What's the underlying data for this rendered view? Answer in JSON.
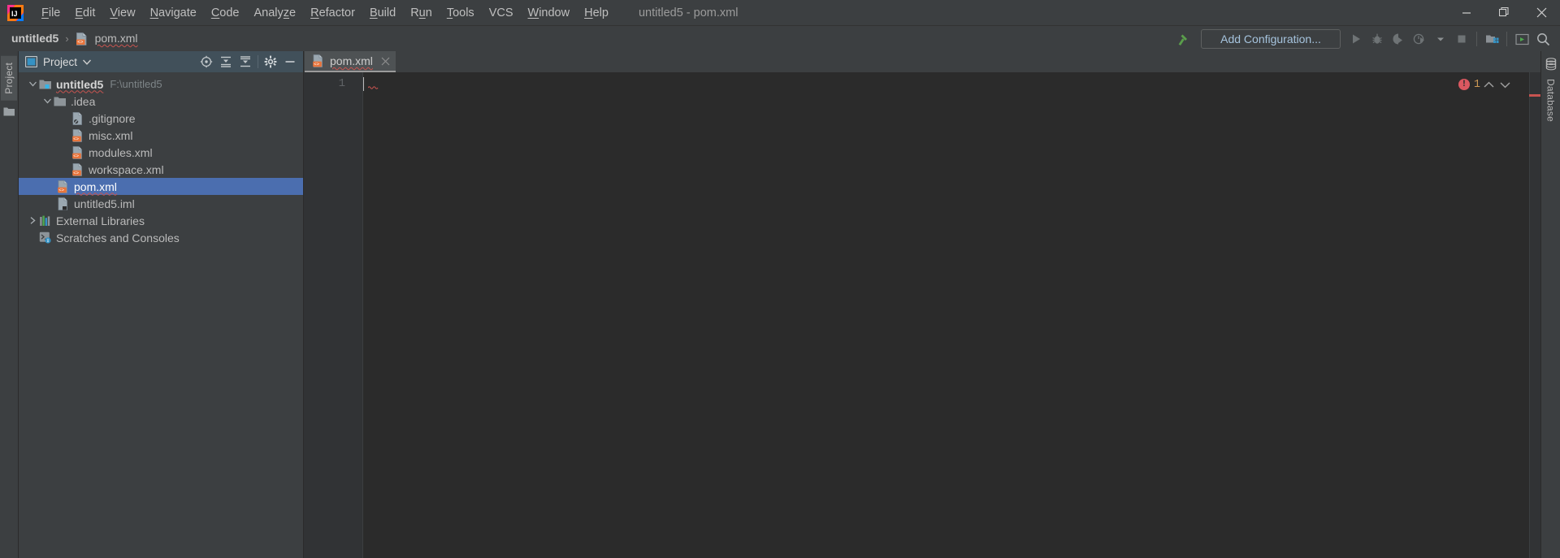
{
  "window": {
    "title": "untitled5 - pom.xml",
    "controls": {
      "minimize": "minimize-icon",
      "maximize": "maximize-icon",
      "close": "close-icon"
    }
  },
  "menubar": {
    "logo": "intellij-idea-logo",
    "items": [
      {
        "label": "File",
        "mnemonic": "F"
      },
      {
        "label": "Edit",
        "mnemonic": "E"
      },
      {
        "label": "View",
        "mnemonic": "V"
      },
      {
        "label": "Navigate",
        "mnemonic": "N"
      },
      {
        "label": "Code",
        "mnemonic": "C"
      },
      {
        "label": "Analyze",
        "mnemonic": "z"
      },
      {
        "label": "Refactor",
        "mnemonic": "R"
      },
      {
        "label": "Build",
        "mnemonic": "B"
      },
      {
        "label": "Run",
        "mnemonic": "u"
      },
      {
        "label": "Tools",
        "mnemonic": "T"
      },
      {
        "label": "VCS",
        "mnemonic": ""
      },
      {
        "label": "Window",
        "mnemonic": "W"
      },
      {
        "label": "Help",
        "mnemonic": "H"
      }
    ]
  },
  "navbar": {
    "breadcrumbs": [
      {
        "label": "untitled5",
        "icon": "",
        "bold": true
      },
      {
        "label": "pom.xml",
        "icon": "xml-file-icon",
        "bold": false
      }
    ],
    "separator": "›",
    "hammer_icon": "build-hammer-icon",
    "run_configuration": "Add Configuration...",
    "buttons": [
      {
        "name": "run-button",
        "icon": "run-play-icon"
      },
      {
        "name": "debug-button",
        "icon": "debug-bug-icon"
      },
      {
        "name": "run-coverage-button",
        "icon": "run-with-coverage-icon"
      },
      {
        "name": "profiler-button",
        "icon": "profiler-icon"
      },
      {
        "name": "profiler-dropdown",
        "icon": "chevron-down-icon"
      },
      {
        "name": "stop-button",
        "icon": "stop-square-icon"
      },
      {
        "name": "project-structure-button",
        "icon": "project-structure-icon"
      },
      {
        "name": "terminal-button",
        "icon": "terminal-icon"
      },
      {
        "name": "search-everywhere-button",
        "icon": "search-icon"
      }
    ]
  },
  "left_rail": {
    "tab_label": "Project",
    "tab_icon": "project-window-icon",
    "extra_icon": "folder-icon"
  },
  "right_rail": {
    "tab_label": "Database",
    "tab_icon": "database-icon"
  },
  "project_panel": {
    "header": {
      "view_icon": "project-view-icon",
      "title": "Project",
      "caret": "chevron-down-icon",
      "actions": [
        {
          "name": "scroll-from-source-button",
          "icon": "target-crosshair-icon"
        },
        {
          "name": "expand-all-button",
          "icon": "expand-all-icon"
        },
        {
          "name": "collapse-all-button",
          "icon": "collapse-all-icon"
        },
        {
          "name": "settings-button",
          "icon": "gear-icon"
        },
        {
          "name": "hide-button",
          "icon": "minimize-dash-icon"
        }
      ]
    },
    "tree": [
      {
        "label": "untitled5",
        "path": "F:\\untitled5",
        "icon": "module-folder-icon",
        "indent": 0,
        "arrow": "expanded",
        "bold": true,
        "selected": false,
        "squiggle": true
      },
      {
        "label": ".idea",
        "path": "",
        "icon": "folder-icon",
        "indent": 1,
        "arrow": "expanded",
        "bold": false,
        "selected": false,
        "squiggle": false
      },
      {
        "label": ".gitignore",
        "path": "",
        "icon": "gitignore-file-icon",
        "indent": 2,
        "arrow": "none",
        "bold": false,
        "selected": false,
        "squiggle": false
      },
      {
        "label": "misc.xml",
        "path": "",
        "icon": "xml-file-icon",
        "indent": 2,
        "arrow": "none",
        "bold": false,
        "selected": false,
        "squiggle": false
      },
      {
        "label": "modules.xml",
        "path": "",
        "icon": "xml-file-icon",
        "indent": 2,
        "arrow": "none",
        "bold": false,
        "selected": false,
        "squiggle": false
      },
      {
        "label": "workspace.xml",
        "path": "",
        "icon": "xml-file-icon",
        "indent": 2,
        "arrow": "none",
        "bold": false,
        "selected": false,
        "squiggle": false
      },
      {
        "label": "pom.xml",
        "path": "",
        "icon": "xml-file-icon",
        "indent": 1,
        "arrow": "none",
        "bold": false,
        "selected": true,
        "squiggle": true
      },
      {
        "label": "untitled5.iml",
        "path": "",
        "icon": "iml-file-icon",
        "indent": 1,
        "arrow": "none",
        "bold": false,
        "selected": false,
        "squiggle": false
      },
      {
        "label": "External Libraries",
        "path": "",
        "icon": "libraries-icon",
        "indent": 0,
        "arrow": "collapsed",
        "bold": false,
        "selected": false,
        "squiggle": false
      },
      {
        "label": "Scratches and Consoles",
        "path": "",
        "icon": "scratches-icon",
        "indent": 0,
        "arrow": "none",
        "bold": false,
        "selected": false,
        "squiggle": false
      }
    ]
  },
  "editor": {
    "tabs": [
      {
        "label": "pom.xml",
        "icon": "xml-file-icon",
        "active": true,
        "close_icon": "close-icon",
        "squiggle": true
      }
    ],
    "line_numbers": [
      "1"
    ],
    "content_lines": [
      ""
    ],
    "inspection": {
      "error_icon": "error-circle-icon",
      "error_count": "1",
      "prev_icon": "chevron-up-icon",
      "next_icon": "chevron-down-icon"
    }
  },
  "colors": {
    "bg_panel": "#3c3f41",
    "bg_editor": "#2b2b2b",
    "bg_gutter": "#313335",
    "selection": "#4b6eaf",
    "header_blue": "#41505a",
    "error_red": "#db5860",
    "link_blue": "#a6c4de",
    "accent_orange": "#e8743b",
    "green": "#5a9e4b"
  }
}
